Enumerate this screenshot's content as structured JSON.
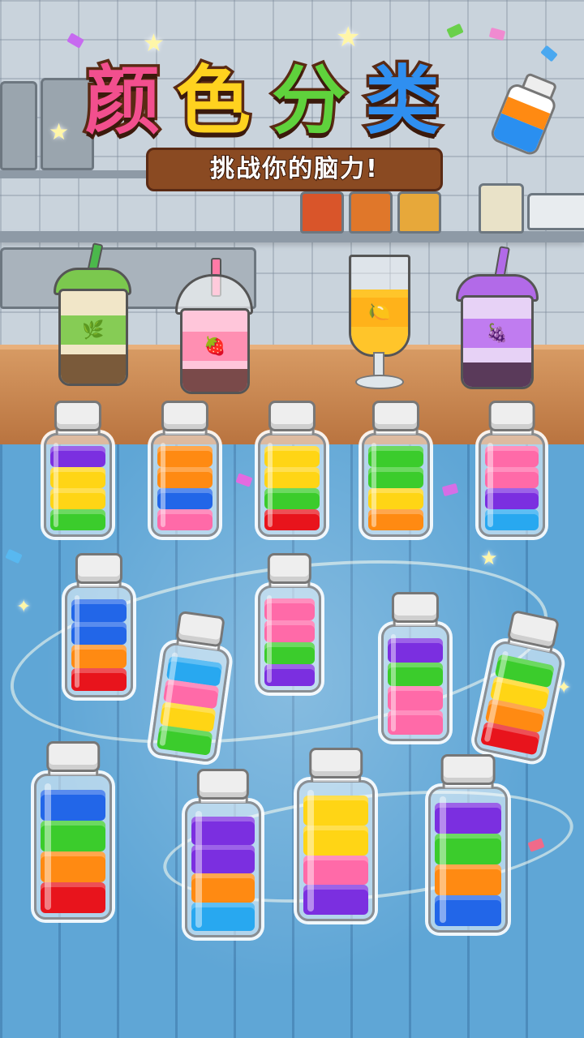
{
  "title": {
    "chars": [
      "颜",
      "色",
      "分",
      "类"
    ],
    "char_colors": [
      "#f24f8e",
      "#ffd21f",
      "#5fd23c",
      "#2f8ff0"
    ]
  },
  "subtitle": "挑战你的脑力!",
  "colors": {
    "purple": "#7b2fe0",
    "yellow": "#ffd515",
    "green": "#3bcc2c",
    "orange": "#ff8a12",
    "blue": "#2266e8",
    "pink": "#ff6aa8",
    "red": "#e8141c",
    "sky": "#28a8f0"
  },
  "drinks": [
    {
      "name": "milk-tea",
      "icon": "leaf-icon",
      "glyph": "🌿"
    },
    {
      "name": "strawberry-tea",
      "icon": "strawberry-icon",
      "glyph": "🍓"
    },
    {
      "name": "lemon-juice",
      "icon": "lemon-icon",
      "glyph": "🍋"
    },
    {
      "name": "grape-tea",
      "icon": "grape-icon",
      "glyph": "🍇"
    }
  ],
  "tubes": [
    [
      "green",
      "yellow",
      "yellow",
      "purple"
    ],
    [
      "pink",
      "blue",
      "orange",
      "orange"
    ],
    [
      "red",
      "green",
      "yellow",
      "yellow"
    ],
    [
      "orange",
      "yellow",
      "green",
      "green"
    ],
    [
      "sky",
      "purple",
      "pink",
      "pink"
    ],
    [
      "red",
      "orange",
      "blue",
      "blue"
    ],
    [
      "purple",
      "green",
      "pink",
      "pink"
    ],
    [
      "green",
      "yellow",
      "pink",
      "sky"
    ],
    [
      "pink",
      "pink",
      "green",
      "purple"
    ],
    [
      "red",
      "orange",
      "yellow",
      "green"
    ],
    [
      "red",
      "orange",
      "green",
      "blue"
    ],
    [
      "sky",
      "orange",
      "purple",
      "purple"
    ],
    [
      "purple",
      "pink",
      "yellow",
      "yellow"
    ],
    [
      "blue",
      "orange",
      "green",
      "purple"
    ]
  ]
}
